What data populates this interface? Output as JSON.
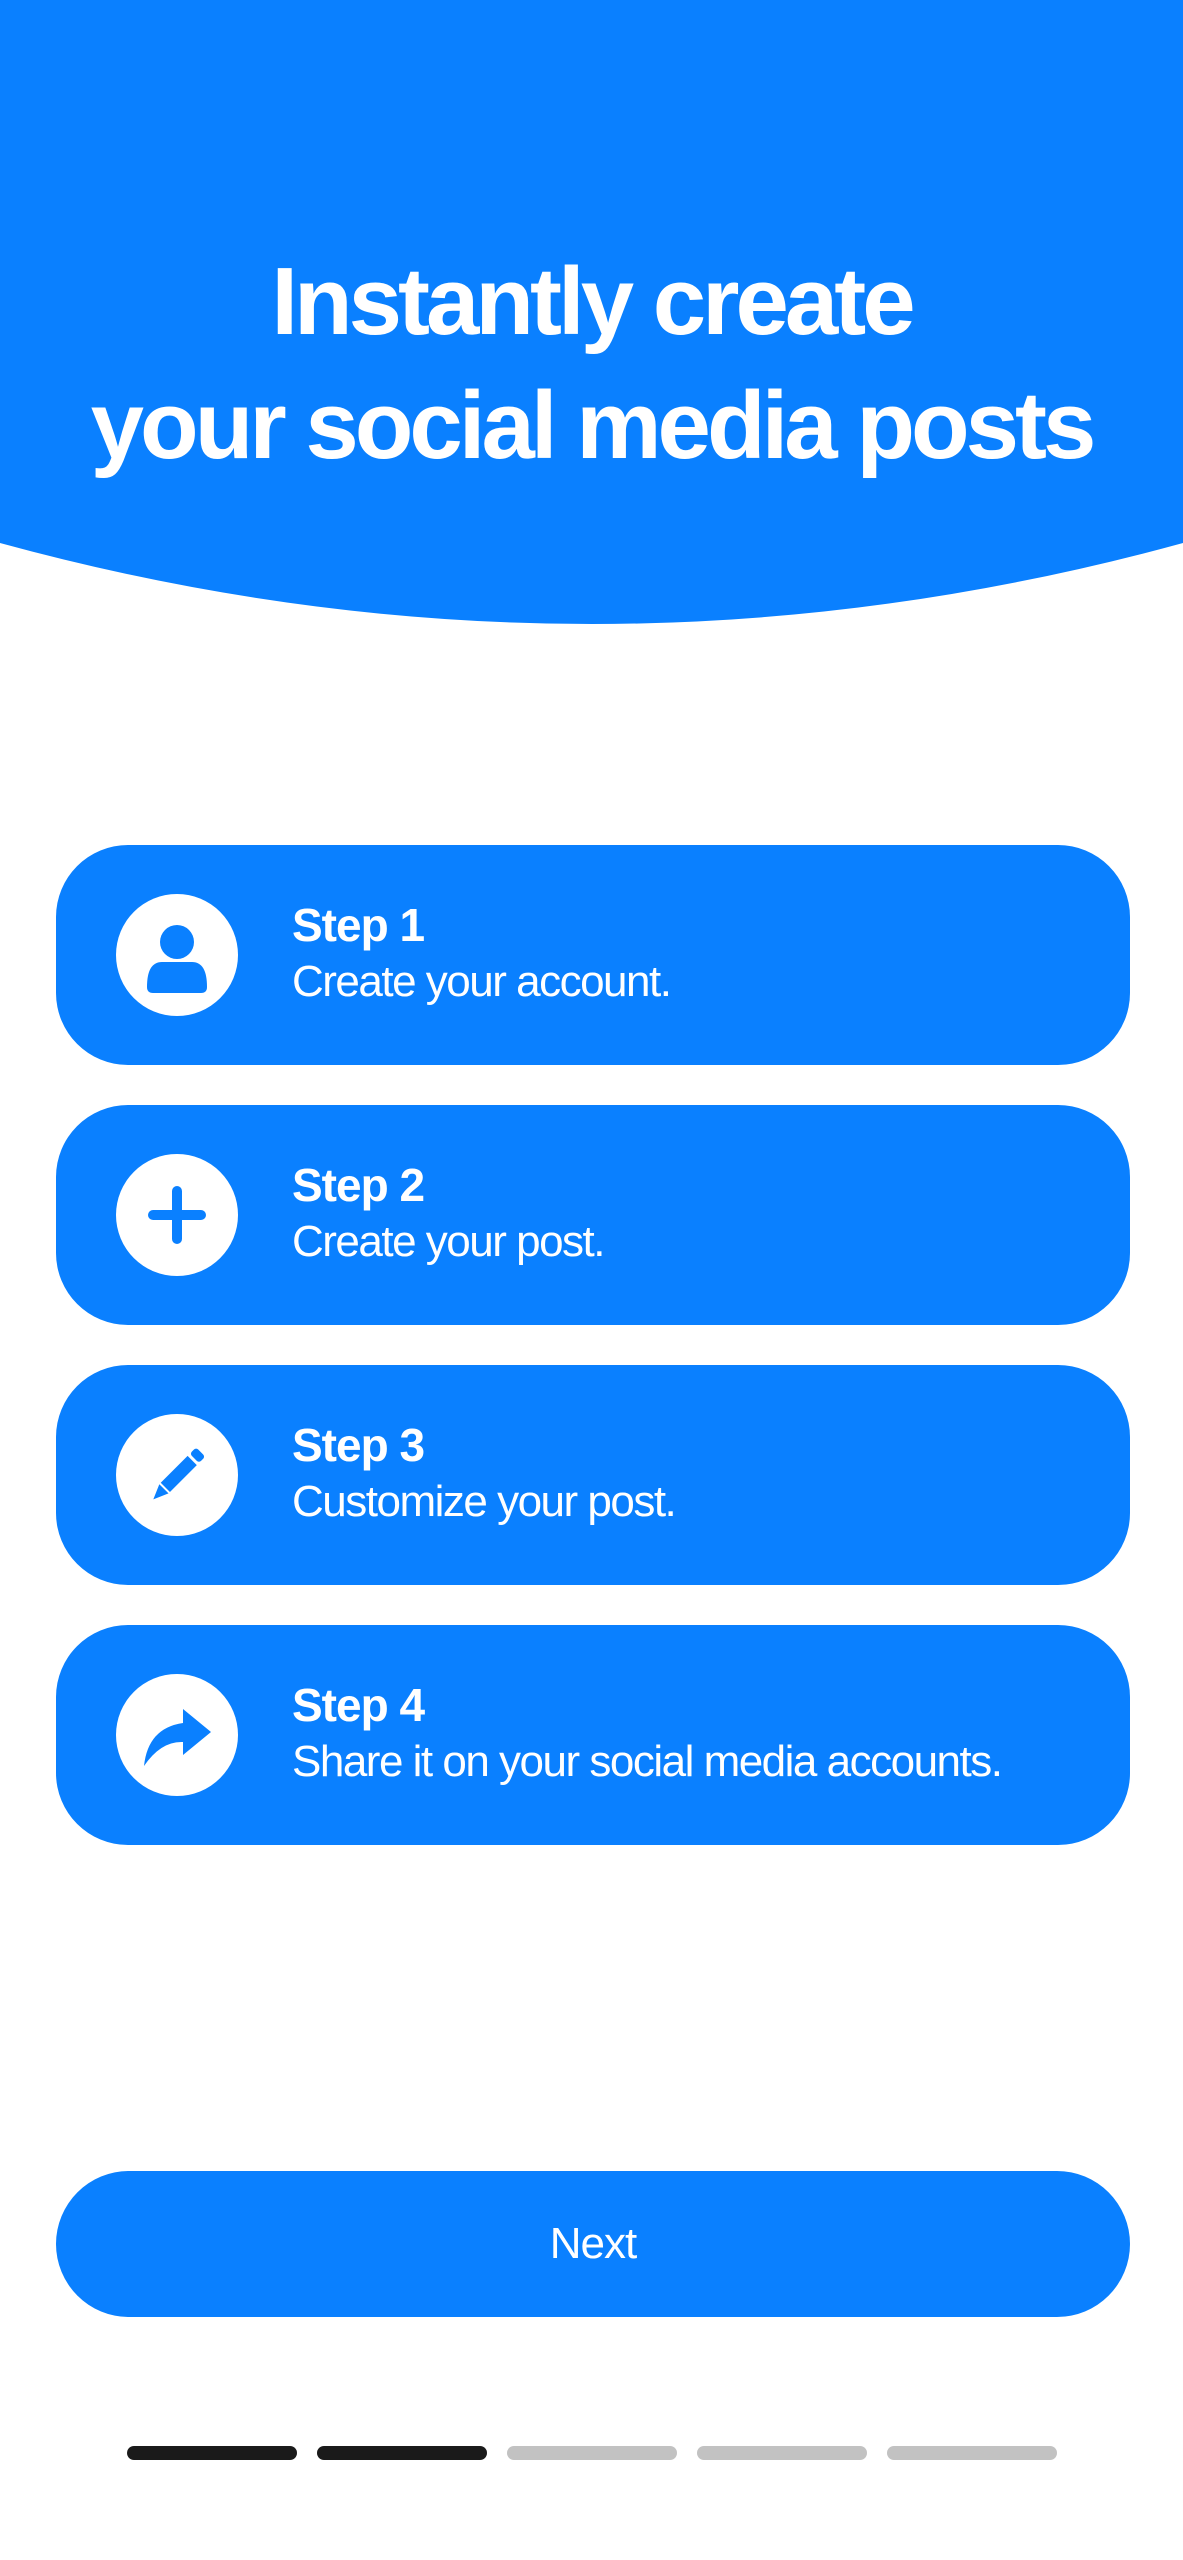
{
  "hero": {
    "title_line1": "Instantly create",
    "title_line2": "your social media posts",
    "color": "#0a80ff"
  },
  "steps": [
    {
      "title": "Step 1",
      "description": "Create your account.",
      "icon": "user-icon"
    },
    {
      "title": "Step 2",
      "description": "Create your post.",
      "icon": "plus-icon"
    },
    {
      "title": "Step 3",
      "description": "Customize your post.",
      "icon": "pencil-icon"
    },
    {
      "title": "Step 4",
      "description": "Share it on your social media accounts.",
      "icon": "share-icon"
    }
  ],
  "next_button": {
    "label": "Next"
  },
  "pager": {
    "total": 5,
    "active": [
      1,
      2
    ],
    "active_color": "#1a1a1a",
    "inactive_color": "#c2c2c2"
  },
  "colors": {
    "accent": "#0a80ff",
    "background": "#ffffff",
    "text_on_accent": "#ffffff"
  }
}
